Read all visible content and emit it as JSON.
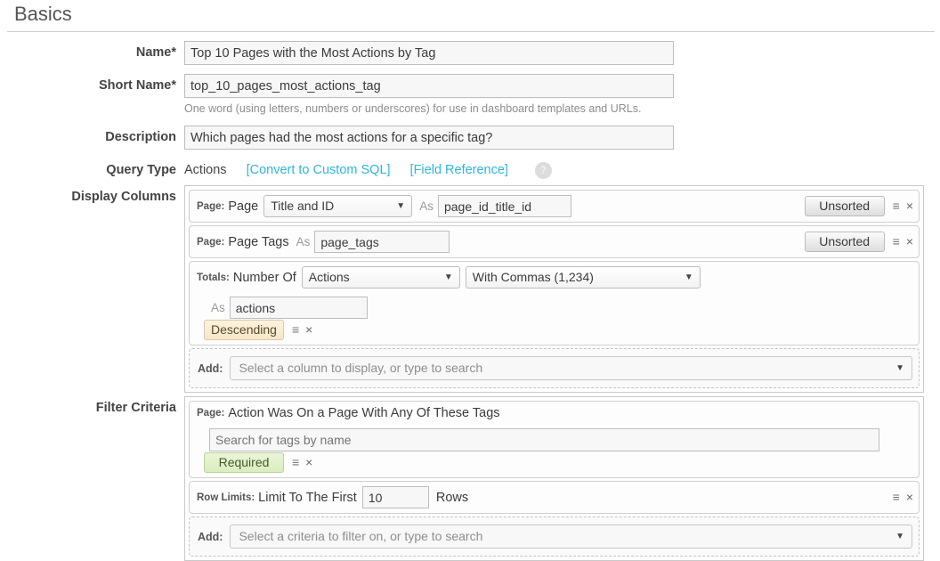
{
  "section": {
    "title": "Basics"
  },
  "fields": {
    "name": {
      "label": "Name*",
      "value": "Top 10 Pages with the Most Actions by Tag"
    },
    "short_name": {
      "label": "Short Name*",
      "value": "top_10_pages_most_actions_tag",
      "help": "One word (using letters, numbers or underscores) for use in dashboard templates and URLs."
    },
    "description": {
      "label": "Description",
      "value": "Which pages had the most actions for a specific tag?"
    },
    "query_type": {
      "label": "Query Type",
      "value": "Actions",
      "convert_link": "[Convert to Custom SQL]",
      "field_reference_link": "[Field Reference]",
      "help_icon": "question-mark-icon",
      "help_glyph": "?"
    },
    "display_columns": {
      "label": "Display Columns"
    },
    "filter_criteria": {
      "label": "Filter Criteria"
    }
  },
  "display_columns": {
    "rows": [
      {
        "category": "Page:",
        "text": "Page",
        "select": "Title and ID",
        "as_label": "As",
        "alias": "page_id_title_id",
        "sort": "Unsorted"
      },
      {
        "category": "Page:",
        "text": "Page Tags",
        "as_label": "As",
        "alias": "page_tags",
        "sort": "Unsorted"
      },
      {
        "category": "Totals:",
        "text": "Number Of",
        "select": "Actions",
        "format_select": "With Commas (1,234)",
        "as_label": "As",
        "alias": "actions",
        "sort": "Descending"
      }
    ],
    "add": {
      "label": "Add:",
      "placeholder": "Select a column to display, or type to search"
    }
  },
  "filter_criteria": {
    "rows": [
      {
        "category": "Page:",
        "text": "Action Was On a Page With Any Of These Tags",
        "search_placeholder": "Search for tags by name",
        "state": "Required"
      },
      {
        "category": "Row Limits:",
        "text": "Limit To The First",
        "value": "10",
        "suffix": "Rows"
      }
    ],
    "add": {
      "label": "Add:",
      "placeholder": "Select a criteria to filter on, or type to search"
    }
  },
  "icons": {
    "grip": "≡",
    "close": "×",
    "caret_down": "▼"
  },
  "colors": {
    "link": "#2fb7d8",
    "descending_bg": "#f7e7c8",
    "required_bg": "#dbedc0"
  }
}
